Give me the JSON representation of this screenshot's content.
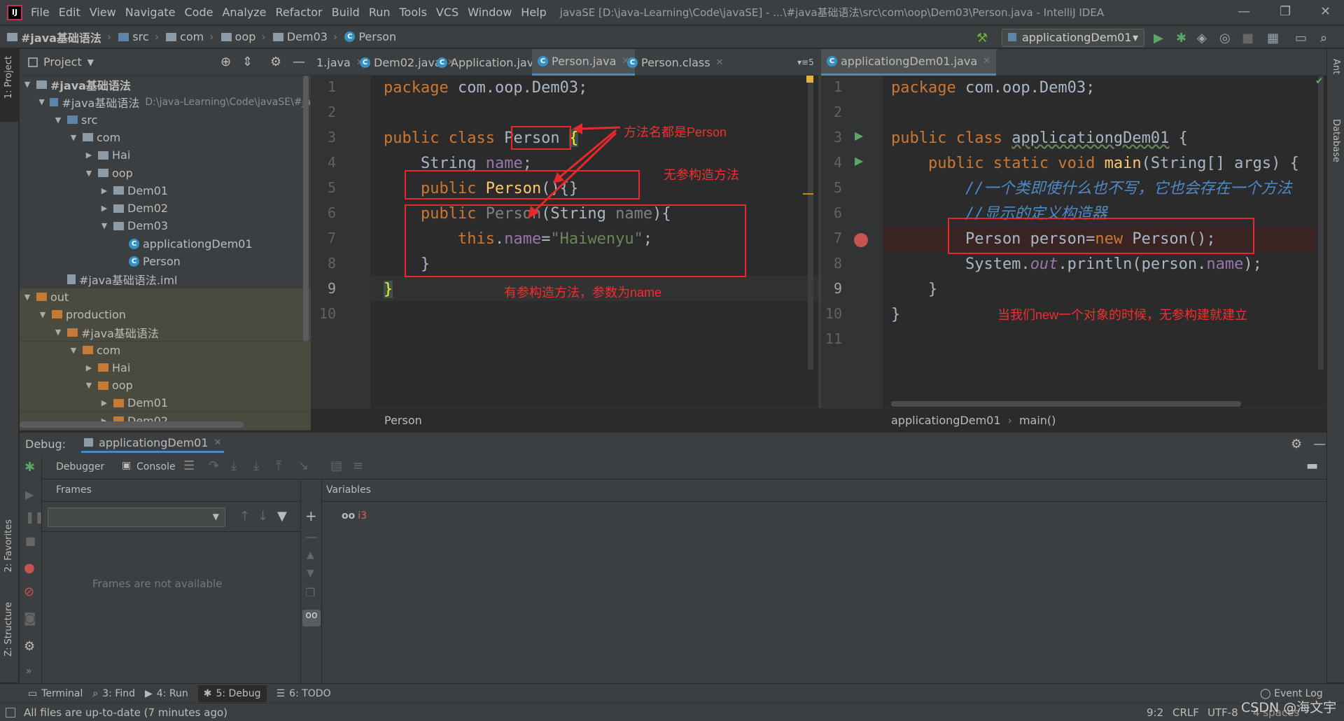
{
  "menu": {
    "items": [
      "File",
      "Edit",
      "View",
      "Navigate",
      "Code",
      "Analyze",
      "Refactor",
      "Build",
      "Run",
      "Tools",
      "VCS",
      "Window",
      "Help"
    ],
    "window_title": "javaSE [D:\\java-Learning\\Code\\javaSE] - ...\\#java基础语法\\src\\com\\oop\\Dem03\\Person.java - IntelliJ IDEA"
  },
  "breadcrumb": [
    "#java基础语法",
    "src",
    "com",
    "oop",
    "Dem03",
    "Person"
  ],
  "run_config": "applicationgDem01",
  "left_strip": {
    "project": "1: Project",
    "favorites": "2: Favorites",
    "structure": "Z: Structure"
  },
  "right_strip": {
    "ant": "Ant",
    "database": "Database"
  },
  "project_panel": {
    "title": "Project",
    "tree": [
      {
        "label": "#java基础语法",
        "depth": 0,
        "arrow": "open",
        "icon": "folder"
      },
      {
        "label": "#java基础语法",
        "depth": 1,
        "arrow": "open",
        "icon": "module",
        "path": "D:\\java-Learning\\Code\\javaSE\\#ja"
      },
      {
        "label": "src",
        "depth": 2,
        "arrow": "open",
        "icon": "folder-blue"
      },
      {
        "label": "com",
        "depth": 3,
        "arrow": "open",
        "icon": "folder"
      },
      {
        "label": "Hai",
        "depth": 4,
        "arrow": "closed",
        "icon": "folder"
      },
      {
        "label": "oop",
        "depth": 4,
        "arrow": "open",
        "icon": "folder"
      },
      {
        "label": "Dem01",
        "depth": 5,
        "arrow": "closed",
        "icon": "folder"
      },
      {
        "label": "Dem02",
        "depth": 5,
        "arrow": "closed",
        "icon": "folder"
      },
      {
        "label": "Dem03",
        "depth": 5,
        "arrow": "open",
        "icon": "folder"
      },
      {
        "label": "applicationgDem01",
        "depth": 6,
        "arrow": "none",
        "icon": "class"
      },
      {
        "label": "Person",
        "depth": 6,
        "arrow": "none",
        "icon": "class"
      },
      {
        "label": "#java基础语法.iml",
        "depth": 2,
        "arrow": "none",
        "icon": "iml"
      },
      {
        "label": "out",
        "depth": 0,
        "arrow": "open",
        "icon": "folder-orange",
        "out": true
      },
      {
        "label": "production",
        "depth": 1,
        "arrow": "open",
        "icon": "folder-orange",
        "out": true
      },
      {
        "label": "#java基础语法",
        "depth": 2,
        "arrow": "open",
        "icon": "folder-orange",
        "out": true
      },
      {
        "label": "com",
        "depth": 3,
        "arrow": "open",
        "icon": "folder-orange",
        "out": true
      },
      {
        "label": "Hai",
        "depth": 4,
        "arrow": "closed",
        "icon": "folder-orange",
        "out": true
      },
      {
        "label": "oop",
        "depth": 4,
        "arrow": "open",
        "icon": "folder-orange",
        "out": true
      },
      {
        "label": "Dem01",
        "depth": 5,
        "arrow": "closed",
        "icon": "folder-orange",
        "out": true
      },
      {
        "label": "Dem02",
        "depth": 5,
        "arrow": "closed",
        "icon": "folder-orange",
        "out": true
      }
    ]
  },
  "tabs_left": [
    {
      "label": "1.java",
      "icon": "none"
    },
    {
      "label": "Dem02.java",
      "icon": "class"
    },
    {
      "label": "Application.java",
      "icon": "class"
    },
    {
      "label": "Person.java",
      "icon": "class",
      "active": true
    },
    {
      "label": "Person.class",
      "icon": "class"
    }
  ],
  "tabs_overflow": "5",
  "tabs_right": [
    {
      "label": "applicationgDem01.java",
      "icon": "class",
      "active": true
    }
  ],
  "editor_left": {
    "line_numbers": [
      "1",
      "2",
      "3",
      "4",
      "5",
      "6",
      "7",
      "8",
      "9",
      "10"
    ],
    "breadcrumb": "Person",
    "annotations": {
      "same_name": "方法名都是Person",
      "no_arg": "无参构造方法",
      "with_arg": "有参构造方法，参数为name"
    }
  },
  "editor_right": {
    "line_numbers": [
      "1",
      "2",
      "3",
      "4",
      "5",
      "6",
      "7",
      "8",
      "9",
      "10",
      "11"
    ],
    "breadcrumb_class": "applicationgDem01",
    "breadcrumb_method": "main()",
    "annotations": {
      "new_obj": "当我们new一个对象的时候，无参构建就建立"
    }
  },
  "debug": {
    "title": "Debug:",
    "session": "applicationgDem01",
    "tabs": [
      "Debugger",
      "Console"
    ],
    "frames_title": "Frames",
    "variables_title": "Variables",
    "frames_empty": "Frames are not available",
    "watch": "i3"
  },
  "bottom_tools": [
    {
      "label": "Terminal",
      "icon": "terminal"
    },
    {
      "label": "3: Find",
      "icon": "search"
    },
    {
      "label": "4: Run",
      "icon": "play"
    },
    {
      "label": "5: Debug",
      "icon": "bug",
      "active": true
    },
    {
      "label": "6: TODO",
      "icon": "list"
    }
  ],
  "event_log": "Event Log",
  "status": {
    "message": "All files are up-to-date (7 minutes ago)",
    "position": "9:2",
    "line_sep": "CRLF",
    "encoding": "UTF-8",
    "indent": "4 spaces",
    "watermark": "CSDN @海文宇"
  },
  "colors": {
    "keyword": "#cc7832",
    "method": "#ffc66d",
    "field": "#9876aa",
    "string": "#6a8759",
    "comment": "#4d8ac7",
    "annotation": "#f03030",
    "accent": "#4a88c7"
  }
}
